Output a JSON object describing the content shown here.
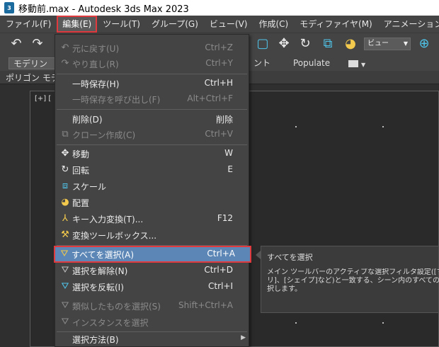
{
  "window": {
    "title": "移動前.max - Autodesk 3ds Max 2023",
    "app_icon_text": "3"
  },
  "menubar": [
    {
      "label": "ファイル(F)",
      "active": false
    },
    {
      "label": "編集(E)",
      "active": true
    },
    {
      "label": "ツール(T)",
      "active": false
    },
    {
      "label": "グループ(G)",
      "active": false
    },
    {
      "label": "ビュー(V)",
      "active": false
    },
    {
      "label": "作成(C)",
      "active": false
    },
    {
      "label": "モディファイヤ(M)",
      "active": false
    },
    {
      "label": "アニメーション(",
      "active": false
    }
  ],
  "toolbar": {
    "view_dropdown": "ビュー"
  },
  "ribbon": {
    "tab_modeling": "モデリング",
    "tab_object_paint": "ント",
    "tab_populate": "Populate",
    "sub_label": "ポリゴン モデ"
  },
  "viewport": {
    "label": "[+] ["
  },
  "edit_menu": {
    "items": [
      {
        "label": "元に戻す(U)",
        "shortcut": "Ctrl+Z",
        "enabled": false,
        "icon": "undo-icon"
      },
      {
        "label": "やり直し(R)",
        "shortcut": "Ctrl+Y",
        "enabled": false,
        "icon": "redo-icon"
      },
      {
        "label": "一時保存(H)",
        "shortcut": "Ctrl+H",
        "enabled": true,
        "icon": ""
      },
      {
        "label": "一時保存を呼び出し(F)",
        "shortcut": "Alt+Ctrl+F",
        "enabled": false,
        "icon": ""
      },
      {
        "label": "削除(D)",
        "shortcut": "削除",
        "enabled": true,
        "icon": ""
      },
      {
        "label": "クローン作成(C)",
        "shortcut": "Ctrl+V",
        "enabled": false,
        "icon": "clone-icon"
      },
      {
        "label": "移動",
        "shortcut": "W",
        "enabled": true,
        "icon": "move-icon"
      },
      {
        "label": "回転",
        "shortcut": "E",
        "enabled": true,
        "icon": "rotate-icon"
      },
      {
        "label": "スケール",
        "shortcut": "",
        "enabled": true,
        "icon": "scale-icon"
      },
      {
        "label": "配置",
        "shortcut": "",
        "enabled": true,
        "icon": "placement-icon"
      },
      {
        "label": "キー入力変換(T)...",
        "shortcut": "F12",
        "enabled": true,
        "icon": "transform-type-in-icon"
      },
      {
        "label": "変換ツールボックス...",
        "shortcut": "",
        "enabled": true,
        "icon": "transform-toolbox-icon"
      },
      {
        "label": "すべてを選択(A)",
        "shortcut": "Ctrl+A",
        "enabled": true,
        "icon": "select-all-icon",
        "highlighted": true
      },
      {
        "label": "選択を解除(N)",
        "shortcut": "Ctrl+D",
        "enabled": true,
        "icon": "select-none-icon"
      },
      {
        "label": "選択を反転(I)",
        "shortcut": "Ctrl+I",
        "enabled": true,
        "icon": "select-invert-icon"
      },
      {
        "label": "類似したものを選択(S)",
        "shortcut": "Shift+Ctrl+A",
        "enabled": false,
        "icon": "select-similar-icon"
      },
      {
        "label": "インスタンスを選択",
        "shortcut": "",
        "enabled": false,
        "icon": "select-instances-icon"
      },
      {
        "label": "選択方法(B)",
        "shortcut": "",
        "enabled": true,
        "icon": "",
        "submenu": true
      }
    ]
  },
  "tooltip": {
    "title": "すべてを選択",
    "body_line1": "メイン ツールバーのアクティブな選択フィルタ設定([すべて]、",
    "body_line2": "リ]、[シェイプ]など)と一致する、シーン内のすべてのオブジェ",
    "body_line3": "択します。"
  }
}
